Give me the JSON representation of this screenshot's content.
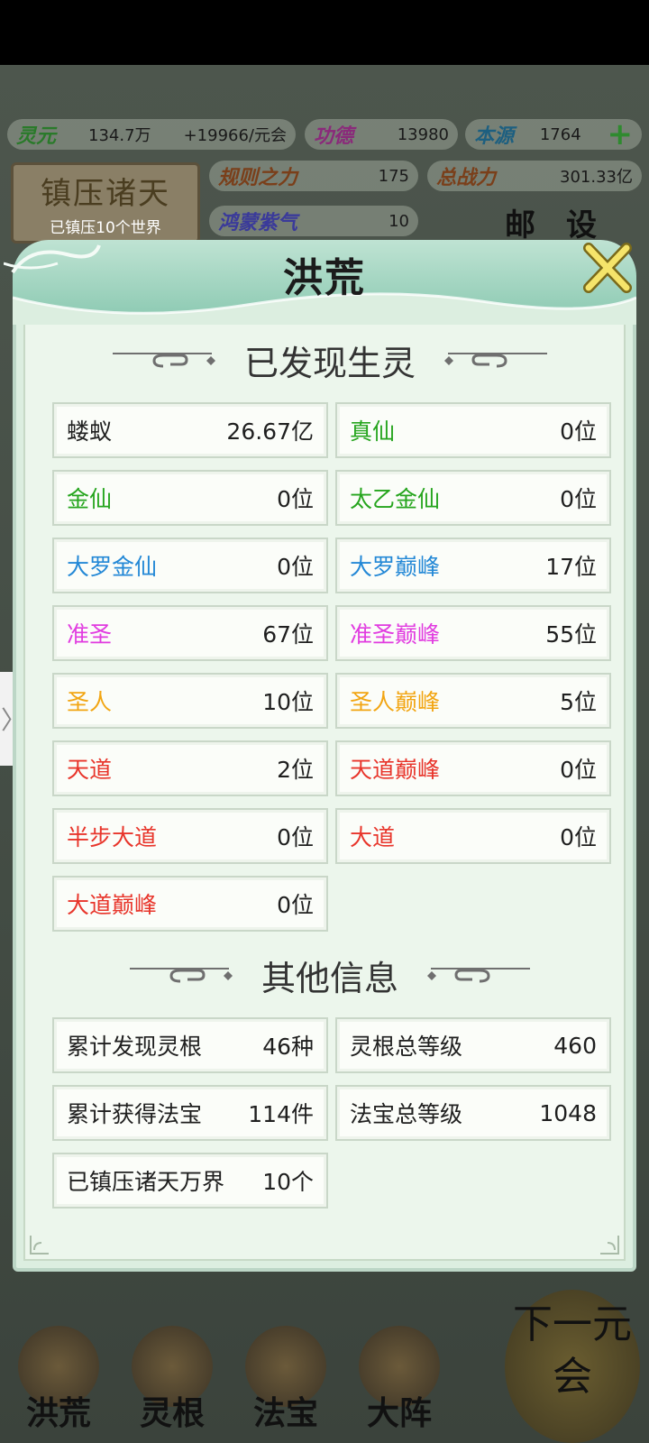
{
  "colors": {
    "black": "#1f1f1f",
    "green": "#26a51e",
    "blue": "#2388d6",
    "magenta": "#e13ce0",
    "orange": "#f2a512",
    "red": "#e8352b"
  },
  "background": {
    "resources": [
      {
        "name": "灵元",
        "value": "134.7万",
        "extra": "+19966/元会"
      },
      {
        "name": "功德",
        "value": "13980"
      },
      {
        "name": "本源",
        "value": "1764"
      }
    ],
    "stats": [
      {
        "name": "规则之力",
        "value": "175"
      },
      {
        "name": "总战力",
        "value": "301.33亿"
      },
      {
        "name": "鸿蒙紫气",
        "value": "10"
      }
    ],
    "suppress_board": {
      "title": "镇压诸天",
      "subtitle": "已镇压10个世界"
    },
    "mail_label": "邮",
    "settings_label": "设",
    "nav": [
      "洪荒",
      "灵根",
      "法宝",
      "大阵"
    ],
    "next_era": "下一元会",
    "side_tab_glyph": "〉"
  },
  "modal": {
    "title": "洪荒",
    "close_icon": "close-x-icon",
    "section1": "已发现生灵",
    "section2": "其他信息",
    "creatures": [
      {
        "label": "蝼蚁",
        "value": "26.67亿",
        "color": "#1f1f1f"
      },
      {
        "label": "真仙",
        "value": "0位",
        "color": "#26a51e"
      },
      {
        "label": "金仙",
        "value": "0位",
        "color": "#26a51e"
      },
      {
        "label": "太乙金仙",
        "value": "0位",
        "color": "#26a51e"
      },
      {
        "label": "大罗金仙",
        "value": "0位",
        "color": "#2388d6"
      },
      {
        "label": "大罗巅峰",
        "value": "17位",
        "color": "#2388d6"
      },
      {
        "label": "准圣",
        "value": "67位",
        "color": "#e13ce0"
      },
      {
        "label": "准圣巅峰",
        "value": "55位",
        "color": "#e13ce0"
      },
      {
        "label": "圣人",
        "value": "10位",
        "color": "#f2a512"
      },
      {
        "label": "圣人巅峰",
        "value": "5位",
        "color": "#f2a512"
      },
      {
        "label": "天道",
        "value": "2位",
        "color": "#e8352b"
      },
      {
        "label": "天道巅峰",
        "value": "0位",
        "color": "#e8352b"
      },
      {
        "label": "半步大道",
        "value": "0位",
        "color": "#e8352b"
      },
      {
        "label": "大道",
        "value": "0位",
        "color": "#e8352b"
      },
      {
        "label": "大道巅峰",
        "value": "0位",
        "color": "#e8352b"
      }
    ],
    "other_info": [
      {
        "label": "累计发现灵根",
        "value": "46种"
      },
      {
        "label": "灵根总等级",
        "value": "460"
      },
      {
        "label": "累计获得法宝",
        "value": "114件"
      },
      {
        "label": "法宝总等级",
        "value": "1048"
      },
      {
        "label": "已镇压诸天万界",
        "value": "10个"
      }
    ]
  }
}
